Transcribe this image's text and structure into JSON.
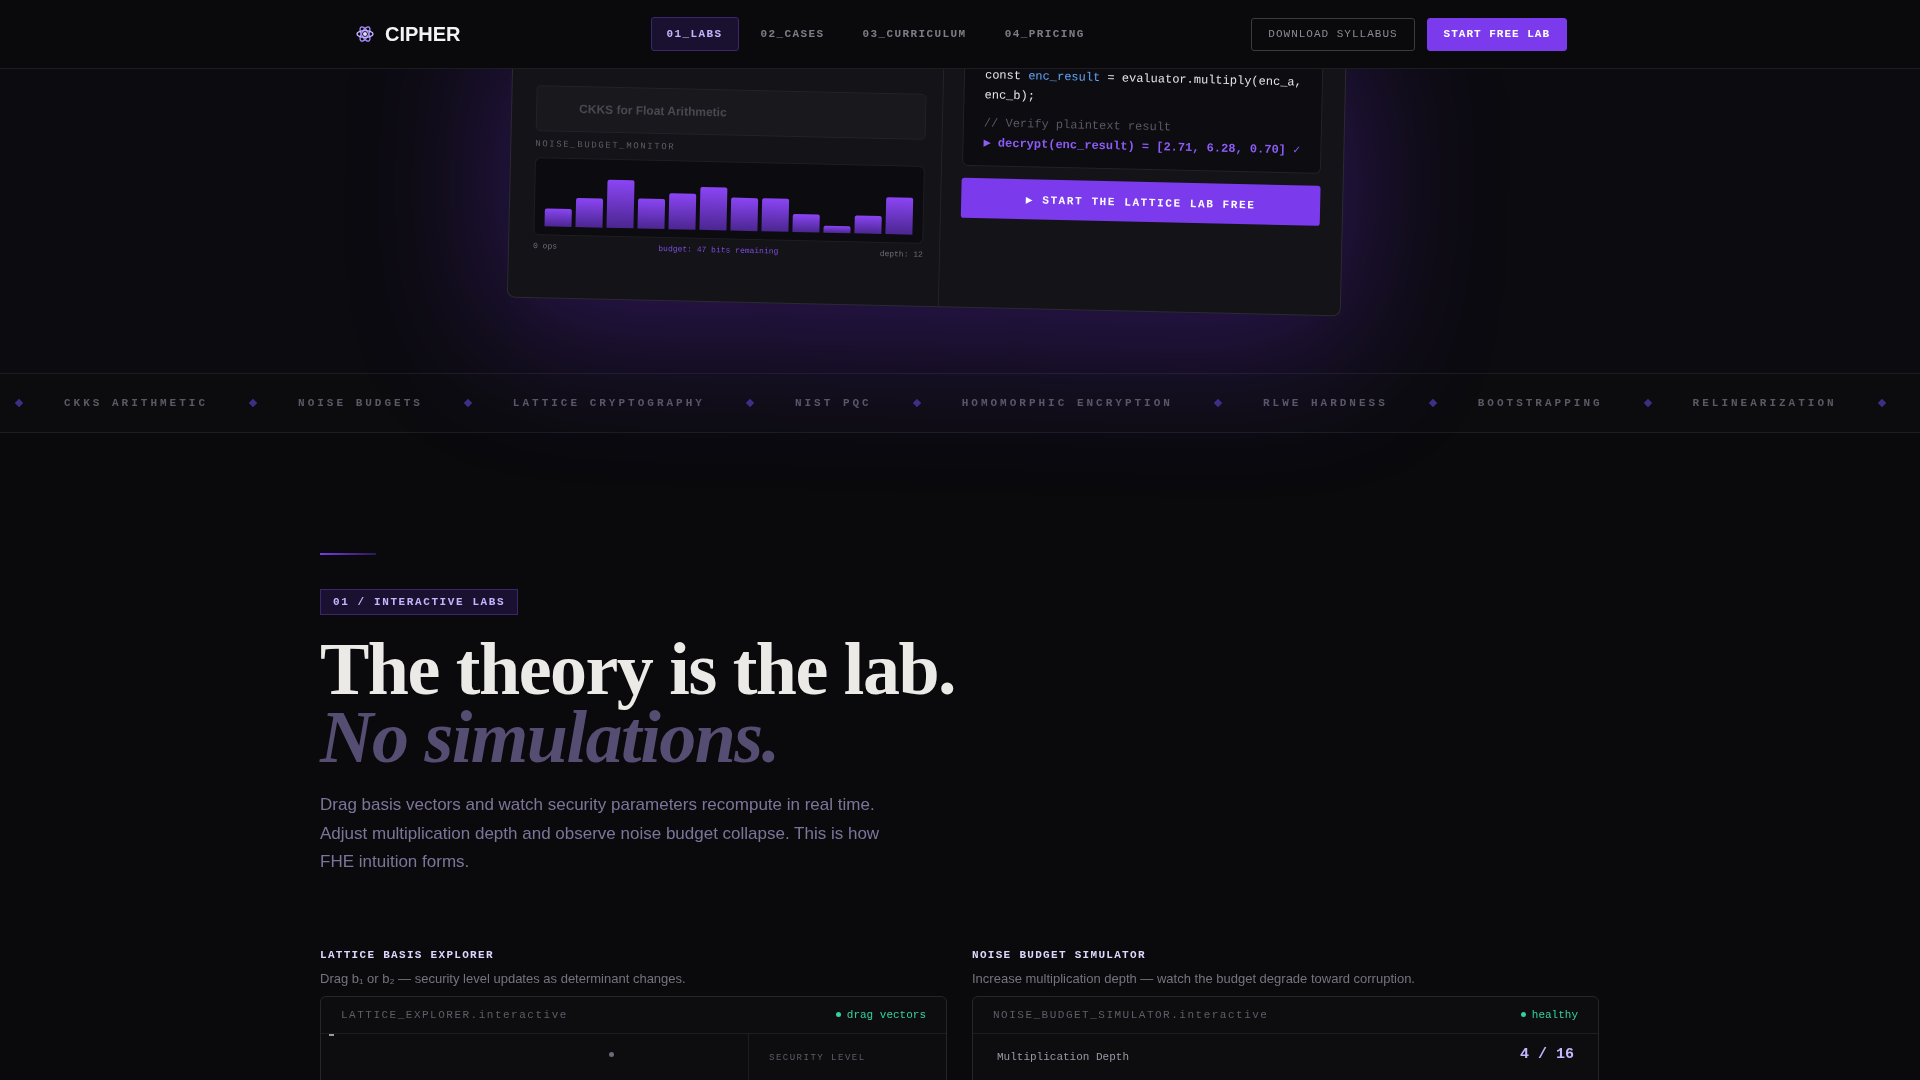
{
  "nav": {
    "brand": "CIPHER",
    "tabs": [
      {
        "label": "01_LABS",
        "selected": true
      },
      {
        "label": "02_CASES",
        "selected": false
      },
      {
        "label": "03_CURRICULUM",
        "selected": false
      },
      {
        "label": "04_PRICING",
        "selected": false
      }
    ],
    "buttons": [
      {
        "label": "DOWNLOAD SYLLABUS",
        "kind": "outline"
      },
      {
        "label": "START FREE LAB",
        "kind": "primary"
      }
    ]
  },
  "preview": {
    "lesson": "CKKS for Float Arithmetic",
    "monitor_title": "NOISE_BUDGET_MONITOR",
    "monitor_labels": [
      {
        "text": "0 ops",
        "kind": "muted"
      },
      {
        "text": "budget: 47 bits remaining",
        "kind": "accent"
      },
      {
        "text": "depth: 12",
        "kind": "muted"
      }
    ],
    "code": [
      [
        {
          "text": "const ",
          "kind": "plain"
        },
        {
          "text": "enc_result",
          "kind": "var"
        },
        {
          "text": " = evaluator.multiply(enc_a,",
          "kind": "plain"
        }
      ],
      [
        {
          "text": "enc_b);",
          "kind": "plain"
        }
      ],
      [
        {
          "text": "// Verify plaintext result",
          "kind": "comment"
        }
      ],
      [
        {
          "text": "▶ decrypt(enc_result) = [2.71, 6.28, 0.70] ✓",
          "kind": "result"
        }
      ]
    ],
    "button": "▶ START THE LATTICE LAB FREE"
  },
  "ticker": [
    "CKKS ARITHMETIC",
    "NOISE BUDGETS",
    "LATTICE CRYPTOGRAPHY",
    "NIST PQC",
    "HOMOMORPHIC ENCRYPTION",
    "RLWE HARDNESS",
    "BOOTSTRAPPING",
    "RELINEARIZATION"
  ],
  "section": {
    "tag": "01 / INTERACTIVE LABS",
    "headline": "The theory is the lab.",
    "headline_italic": "No simulations.",
    "intro": "Drag basis vectors and watch security parameters recompute in real time. Adjust multiplication depth and observe noise budget collapse. This is how FHE intuition forms.",
    "labs": [
      {
        "kind": "lattice",
        "title": "LATTICE BASIS EXPLORER",
        "description": "Drag b₁ or b₂ — security level updates as determinant changes.",
        "header": "LATTICE_EXPLORER.interactive",
        "status": "drag vectors",
        "side_label": "SECURITY LEVEL"
      },
      {
        "kind": "noise",
        "title": "NOISE BUDGET SIMULATOR",
        "description": "Increase multiplication depth — watch the budget degrade toward corruption.",
        "header": "NOISE_BUDGET_SIMULATOR.interactive",
        "status": "healthy",
        "control_label": "Multiplication Depth",
        "control_value": "4 / 16"
      }
    ]
  }
}
